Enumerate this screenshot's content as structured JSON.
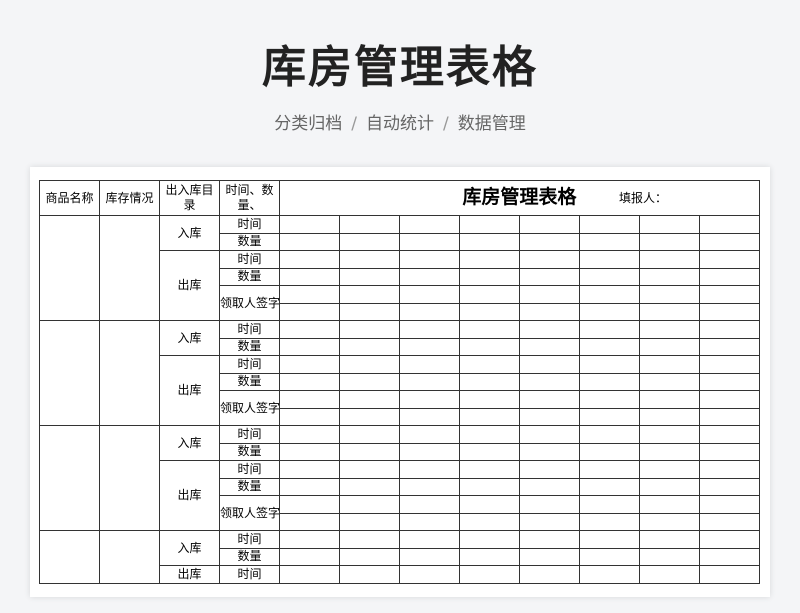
{
  "header": {
    "title": "库房管理表格",
    "tagline": [
      "分类归档",
      "自动统计",
      "数据管理"
    ],
    "separator": "/"
  },
  "sheet": {
    "doc_title": "库房管理表格",
    "filler_label": "填报人：",
    "columns": {
      "product": "商品名称",
      "stock": "库存情况",
      "io_category": "出入库目录",
      "time_qty": "时间、数量、"
    },
    "labels": {
      "in": "入库",
      "out": "出库",
      "time": "时间",
      "qty": "数量",
      "receiver": "领取人签字"
    }
  }
}
